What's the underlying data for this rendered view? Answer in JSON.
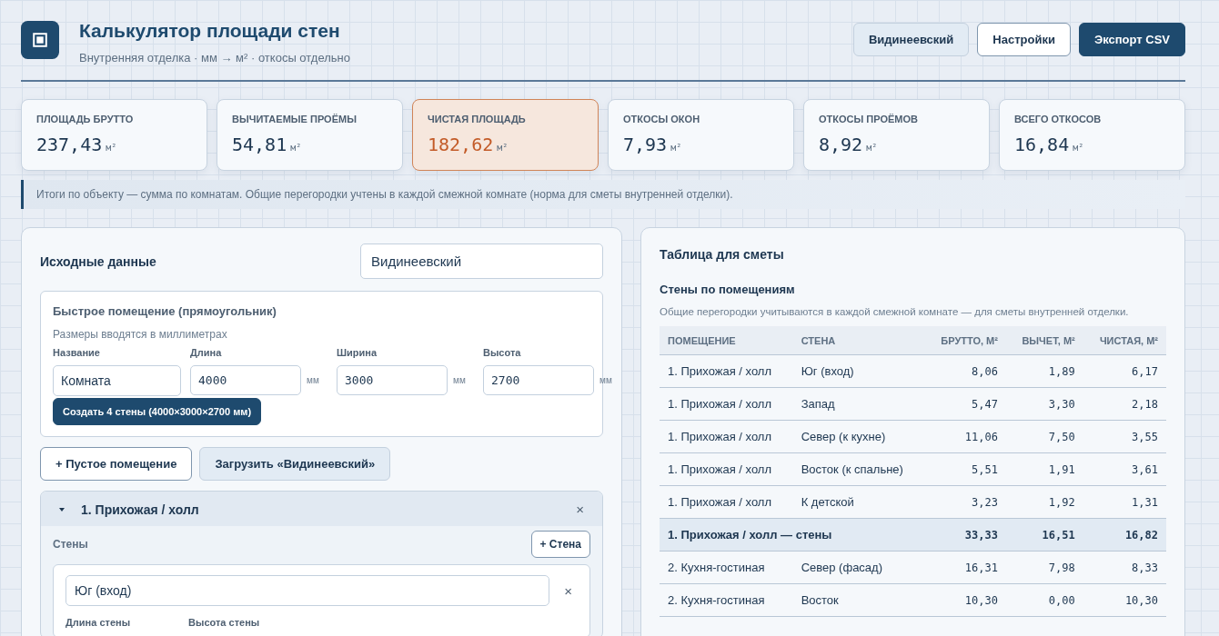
{
  "header": {
    "title": "Калькулятор площади стен",
    "subtitle": "Внутренняя отделка · мм → м² · откосы отдельно",
    "buttons": [
      {
        "label": "Видинеевский",
        "kind": "soft"
      },
      {
        "label": "Настройки",
        "kind": "outline"
      },
      {
        "label": "Экспорт CSV",
        "kind": "primary"
      }
    ]
  },
  "stats": [
    {
      "label": "ПЛОЩАДЬ БРУТТО",
      "value": "237,43",
      "unit": "м²",
      "selected": false
    },
    {
      "label": "ВЫЧИТАЕМЫЕ ПРОЁМЫ",
      "value": "54,81",
      "unit": "м²",
      "selected": false
    },
    {
      "label": "ЧИСТАЯ ПЛОЩАДЬ",
      "value": "182,62",
      "unit": "м²",
      "selected": true
    },
    {
      "label": "ОТКОСЫ ОКОН",
      "value": "7,93",
      "unit": "м²",
      "selected": false
    },
    {
      "label": "ОТКОСЫ ПРОЁМОВ",
      "value": "8,92",
      "unit": "м²",
      "selected": false
    },
    {
      "label": "ВСЕГО ОТКОСОВ",
      "value": "16,84",
      "unit": "м²",
      "selected": false
    }
  ],
  "note": "Итоги по объекту — сумма по комнатам. Общие перегородки учтены в каждой смежной комнате (норма для сметы внутренней отделки).",
  "input_panel": {
    "title": "Исходные данные",
    "object_name": "Видинеевский",
    "quick_room": {
      "title": "Быстрое помещение (прямоугольник)",
      "hint": "Размеры вводятся в миллиметрах",
      "fields": [
        {
          "label": "Название",
          "value": "Комната",
          "kind": "text"
        },
        {
          "label": "Длина",
          "value": "4000",
          "unit": "мм",
          "kind": "number"
        },
        {
          "label": "Ширина",
          "value": "3000",
          "unit": "мм",
          "kind": "number"
        },
        {
          "label": "Высота",
          "value": "2700",
          "unit": "мм",
          "kind": "number"
        }
      ],
      "create_button": "Создать 4 стены (4000×3000×2700 мм)"
    },
    "buttons": [
      {
        "label": "+ Пустое помещение",
        "kind": "outline"
      },
      {
        "label": "Загрузить «Видинеевский»",
        "kind": "soft"
      }
    ],
    "room": {
      "title": "1. Прихожая / холл",
      "expanded": true,
      "close": "×",
      "walls_label": "Стены",
      "add_wall": "+ Стена",
      "wall": {
        "name": "Юг (вход)",
        "close": "×",
        "labels": [
          "Длина стены",
          "Высота стены"
        ]
      }
    }
  },
  "estimate": {
    "title": "Таблица для сметы",
    "subtitle": "Стены по помещениям",
    "hint": "Общие перегородки учитываются в каждой смежной комнате — для сметы внутренней отделки.",
    "columns": [
      "ПОМЕЩЕНИЕ",
      "СТЕНА",
      "БРУТТО, М²",
      "ВЫЧЕТ, М²",
      "ЧИСТАЯ, М²"
    ],
    "rows": [
      {
        "kind": "wall",
        "room": "1. Прихожая / холл",
        "wall": "Юг (вход)",
        "gross": "8,06",
        "deduct": "1,89",
        "net": "6,17"
      },
      {
        "kind": "wall",
        "room": "1. Прихожая / холл",
        "wall": "Запад",
        "gross": "5,47",
        "deduct": "3,30",
        "net": "2,18"
      },
      {
        "kind": "wall",
        "room": "1. Прихожая / холл",
        "wall": "Север (к кухне)",
        "gross": "11,06",
        "deduct": "7,50",
        "net": "3,55"
      },
      {
        "kind": "wall",
        "room": "1. Прихожая / холл",
        "wall": "Восток (к спальне)",
        "gross": "5,51",
        "deduct": "1,91",
        "net": "3,61"
      },
      {
        "kind": "wall",
        "room": "1. Прихожая / холл",
        "wall": "К детской",
        "gross": "3,23",
        "deduct": "1,92",
        "net": "1,31"
      },
      {
        "kind": "subtotal",
        "room": "1. Прихожая / холл — стены",
        "gross": "33,33",
        "deduct": "16,51",
        "net": "16,82"
      },
      {
        "kind": "wall",
        "room": "2. Кухня-гостиная",
        "wall": "Север (фасад)",
        "gross": "16,31",
        "deduct": "7,98",
        "net": "8,33"
      },
      {
        "kind": "wall",
        "room": "2. Кухня-гостиная",
        "wall": "Восток",
        "gross": "10,30",
        "deduct": "0,00",
        "net": "10,30"
      }
    ]
  }
}
